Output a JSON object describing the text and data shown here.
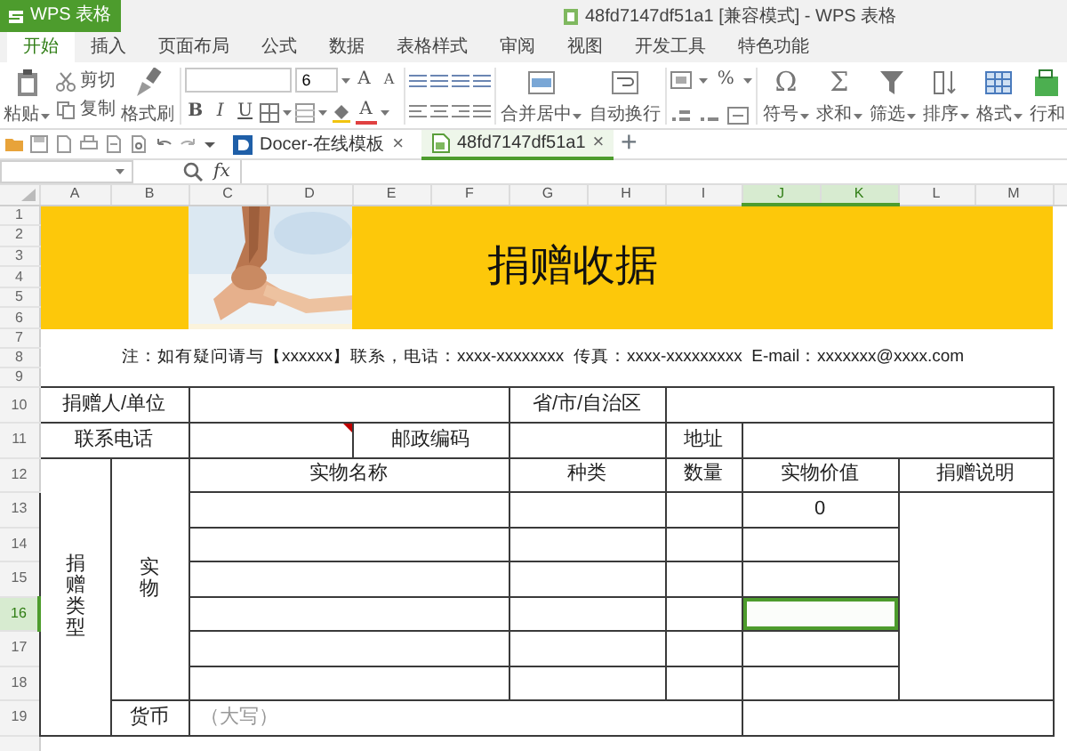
{
  "title_bar": {
    "app_menu": "WPS 表格",
    "title": "48fd7147df51a1 [兼容模式] - WPS 表格"
  },
  "ribbon_tabs": [
    {
      "label": "开始",
      "selected": true
    },
    {
      "label": "插入",
      "selected": false
    },
    {
      "label": "页面布局",
      "selected": false
    },
    {
      "label": "公式",
      "selected": false
    },
    {
      "label": "数据",
      "selected": false
    },
    {
      "label": "表格样式",
      "selected": false
    },
    {
      "label": "审阅",
      "selected": false
    },
    {
      "label": "视图",
      "selected": false
    },
    {
      "label": "开发工具",
      "selected": false
    },
    {
      "label": "特色功能",
      "selected": false
    }
  ],
  "ribbon": [
    {
      "kind": "large",
      "label": "粘贴",
      "dropdown": true
    },
    {
      "kind": "pair",
      "items": [
        {
          "label": "剪切"
        },
        {
          "label": "复制"
        }
      ]
    },
    {
      "kind": "large",
      "label": "格式刷",
      "dropdown": false
    },
    {
      "kind": "font",
      "size": "6",
      "grow": "A",
      "shrink": "A",
      "styles": [
        "B",
        "I",
        "U"
      ],
      "color_button": "A"
    },
    {
      "kind": "align"
    },
    {
      "kind": "large",
      "label": "合并居中",
      "dropdown": true
    },
    {
      "kind": "large",
      "label": "自动换行",
      "dropdown": false
    },
    {
      "kind": "number",
      "percent": "%"
    },
    {
      "kind": "large",
      "label": "符号",
      "glyph": "Ω",
      "dropdown": true
    },
    {
      "kind": "large",
      "label": "求和",
      "glyph": "Σ",
      "dropdown": true
    },
    {
      "kind": "large",
      "label": "筛选",
      "dropdown": true
    },
    {
      "kind": "large",
      "label": "排序",
      "dropdown": true
    },
    {
      "kind": "large",
      "label": "格式",
      "dropdown": true
    },
    {
      "kind": "large",
      "label": "行和",
      "dropdown": false
    }
  ],
  "doc_tabs": [
    {
      "kind": "docer",
      "label": "Docer-在线模板",
      "close": "×",
      "selected": false
    },
    {
      "kind": "sheet",
      "label": "48fd7147df51a1",
      "close": "×",
      "selected": true
    }
  ],
  "new_tab": "+",
  "formula_bar": {
    "function_label": "fx"
  },
  "sheet": {
    "columns": [
      {
        "label": "A",
        "selected": false
      },
      {
        "label": "B",
        "selected": false
      },
      {
        "label": "C",
        "selected": false
      },
      {
        "label": "D",
        "selected": false
      },
      {
        "label": "E",
        "selected": false
      },
      {
        "label": "F",
        "selected": false
      },
      {
        "label": "G",
        "selected": false
      },
      {
        "label": "H",
        "selected": false
      },
      {
        "label": "I",
        "selected": false
      },
      {
        "label": "J",
        "selected": true
      },
      {
        "label": "K",
        "selected": true
      },
      {
        "label": "L",
        "selected": false
      },
      {
        "label": "M",
        "selected": false
      }
    ],
    "rows": [
      {
        "label": "1",
        "selected": false
      },
      {
        "label": "2",
        "selected": false
      },
      {
        "label": "3",
        "selected": false
      },
      {
        "label": "4",
        "selected": false
      },
      {
        "label": "5",
        "selected": false
      },
      {
        "label": "6",
        "selected": false
      },
      {
        "label": "7",
        "selected": false
      },
      {
        "label": "8",
        "selected": false
      },
      {
        "label": "9",
        "selected": false
      },
      {
        "label": "10",
        "selected": false
      },
      {
        "label": "11",
        "selected": false
      },
      {
        "label": "12",
        "selected": false
      },
      {
        "label": "13",
        "selected": false
      },
      {
        "label": "14",
        "selected": false
      },
      {
        "label": "15",
        "selected": false
      },
      {
        "label": "16",
        "selected": true
      },
      {
        "label": "17",
        "selected": false
      },
      {
        "label": "18",
        "selected": false
      },
      {
        "label": "19",
        "selected": false
      }
    ]
  },
  "receipt": {
    "title": "捐赠收据",
    "note": "注：如有疑问请与【xxxxxx】联系，电话：xxxx-xxxxxxxx  传真：xxxx-xxxxxxxxx  E-mail：xxxxxxx@xxxx.com",
    "donor_label": "捐赠人/单位",
    "region_label": "省/市/自治区",
    "phone_label": "联系电话",
    "phone_comment": true,
    "postcode_label": "邮政编码",
    "address_label": "地址",
    "type_label": "捐赠类型",
    "goods_label": "实物",
    "columns": [
      "实物名称",
      "种类",
      "数量",
      "实物价值",
      "捐赠说明"
    ],
    "goods_rows": [
      {
        "selected": false,
        "value": "0"
      },
      {
        "selected": false
      },
      {
        "selected": false
      },
      {
        "selected": true
      },
      {
        "selected": false
      },
      {
        "selected": false
      }
    ],
    "currency_label": "货币",
    "currency_placeholder": "（大写）"
  }
}
